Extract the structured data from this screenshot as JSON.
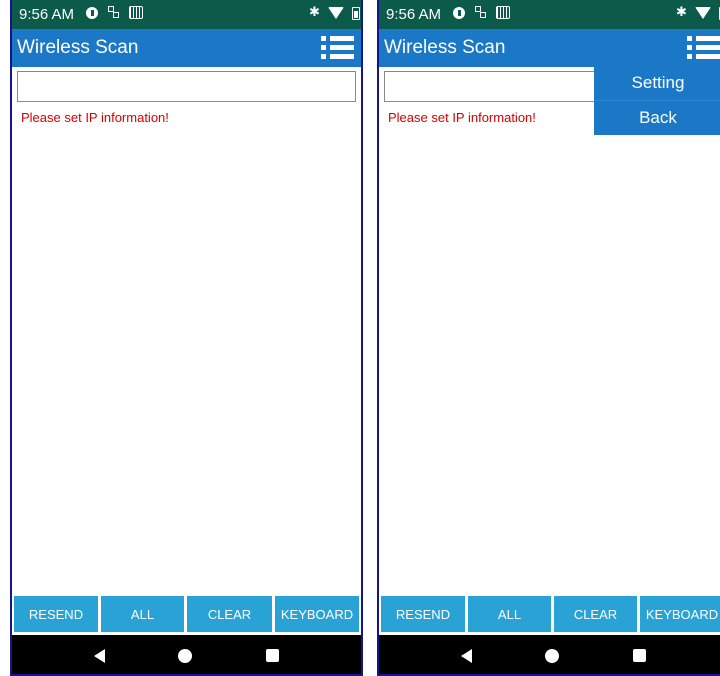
{
  "status_bar": {
    "time": "9:56 AM",
    "icons": [
      "shield-icon",
      "network-icon",
      "barcode-icon",
      "bluetooth-icon",
      "wifi-icon",
      "battery-icon"
    ]
  },
  "app_bar": {
    "title": "Wireless Scan",
    "menu_icon": "menu-icon"
  },
  "scan_input": {
    "value": ""
  },
  "message": {
    "text": "Please set IP information!",
    "color": "#d40000"
  },
  "buttons": {
    "resend": "RESEND",
    "all": "ALL",
    "clear": "CLEAR",
    "keyboard": "KEYBOARD"
  },
  "overflow_menu": {
    "items": [
      {
        "label": "Setting"
      },
      {
        "label": "Back"
      }
    ]
  },
  "navigation": {
    "back_icon": "back-triangle-icon",
    "home_icon": "home-circle-icon",
    "recents_icon": "recents-square-icon"
  },
  "colors": {
    "status_bar": "#0b5a4a",
    "app_bar": "#1b78c6",
    "button": "#29a3d6",
    "nav_bar": "#000000",
    "frame_border": "#14148c"
  }
}
